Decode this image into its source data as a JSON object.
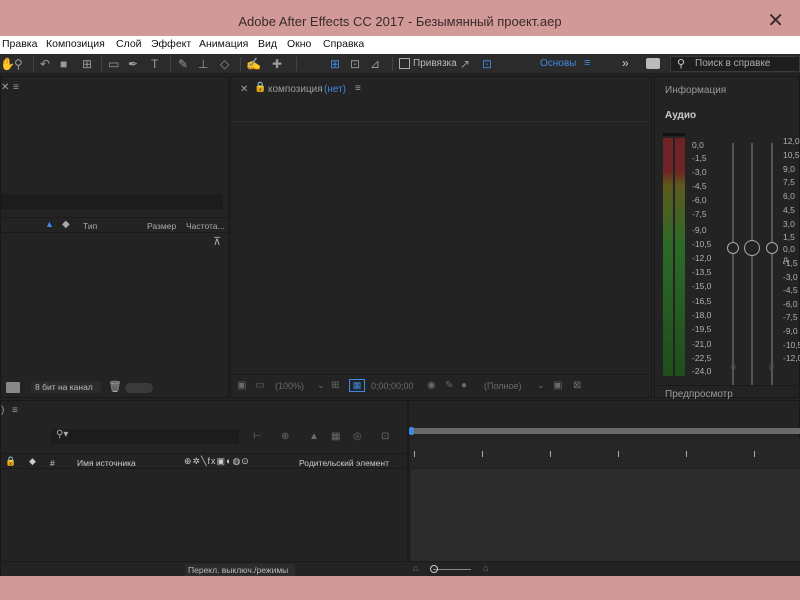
{
  "window": {
    "title": "Adobe After Effects CC 2017 - Безымянный проект.aep",
    "close_glyph": "✕"
  },
  "menu": [
    "Правка",
    "Композиция",
    "Слой",
    "Эффект",
    "Анимация",
    "Вид",
    "Окно",
    "Справка"
  ],
  "toolbar": {
    "snap_label": "Привязка",
    "workspace": "Основы",
    "more_glyph": "»",
    "search_placeholder": "Поиск в справке"
  },
  "project": {
    "columns": [
      "Тип",
      "Размер",
      "Частота..."
    ],
    "bit_depth": "8 бит на канал"
  },
  "composition": {
    "tab_label": "композиция",
    "tab_value": "(нет)",
    "zoom": "(100%)",
    "timecode": "0;00;00;00",
    "resolution": "(Полное)"
  },
  "info": {
    "title": "Информация",
    "audio_label": "Аудио",
    "db_left": [
      "0,0",
      "-1,5",
      "-3,0",
      "-4,5",
      "-6,0",
      "-7,5",
      "-9,0",
      "-10,5",
      "-12,0",
      "-13,5",
      "-15,0",
      "-16,5",
      "-18,0",
      "-19,5",
      "-21,0",
      "-22,5",
      "-24,0"
    ],
    "db_right": [
      "12,0",
      "10,5",
      "9,0",
      "7,5",
      "6,0",
      "4,5",
      "3,0",
      "1,5",
      "0,0 д",
      "-1,5",
      "-3,0",
      "-4,5",
      "-6,0",
      "-7,5",
      "-9,0",
      "-10,5",
      "-12,0"
    ],
    "slider_left": "0",
    "slider_right": "0",
    "preview_label": "Предпросмотр"
  },
  "timeline": {
    "columns": [
      "#",
      "Имя источника",
      "Родительский элемент"
    ],
    "switch_label": "Перекл. выключ./режимы"
  },
  "colors": {
    "accent": "#3f8ae0",
    "titlebar": "#d19a98",
    "panel": "#232323"
  }
}
